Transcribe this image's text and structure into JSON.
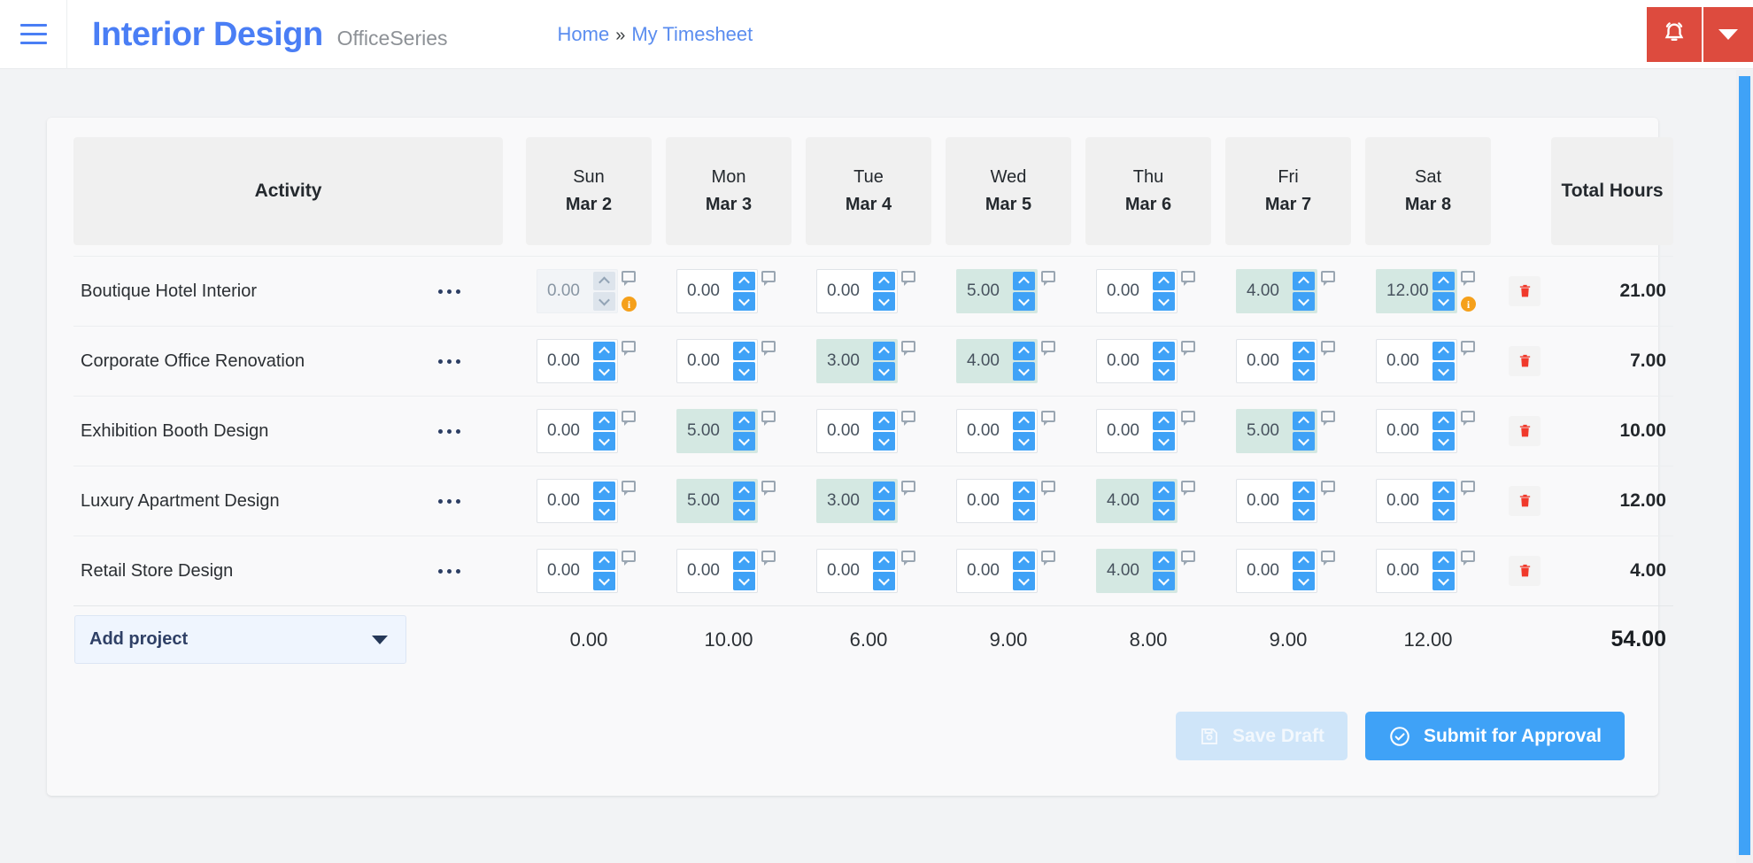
{
  "header": {
    "menu_icon": "hamburger-icon",
    "brand_title": "Interior Design",
    "brand_subtitle": "OfficeSeries",
    "breadcrumb": {
      "home": "Home",
      "separator": "»",
      "current": "My Timesheet"
    },
    "notification_icon": "bell-icon",
    "dropdown_icon": "caret-down-icon",
    "accent_red": "#dd4b3e",
    "accent_blue": "#4a7ef5"
  },
  "table": {
    "activity_header": "Activity",
    "total_header": "Total Hours",
    "days": [
      {
        "name": "Sun",
        "date": "Mar 2"
      },
      {
        "name": "Mon",
        "date": "Mar 3"
      },
      {
        "name": "Tue",
        "date": "Mar 4"
      },
      {
        "name": "Wed",
        "date": "Mar 5"
      },
      {
        "name": "Thu",
        "date": "Mar 6"
      },
      {
        "name": "Fri",
        "date": "Mar 7"
      },
      {
        "name": "Sat",
        "date": "Mar 8"
      }
    ],
    "rows": [
      {
        "activity": "Boutique Hotel Interior",
        "total": "21.00",
        "cells": [
          {
            "value": "0.00",
            "state": "disabled",
            "badge": "i"
          },
          {
            "value": "0.00",
            "state": "empty",
            "badge": ""
          },
          {
            "value": "0.00",
            "state": "empty",
            "badge": ""
          },
          {
            "value": "5.00",
            "state": "filled",
            "badge": ""
          },
          {
            "value": "0.00",
            "state": "empty",
            "badge": ""
          },
          {
            "value": "4.00",
            "state": "filled",
            "badge": ""
          },
          {
            "value": "12.00",
            "state": "filled",
            "badge": "i"
          }
        ]
      },
      {
        "activity": "Corporate Office Renovation",
        "total": "7.00",
        "cells": [
          {
            "value": "0.00",
            "state": "empty",
            "badge": ""
          },
          {
            "value": "0.00",
            "state": "empty",
            "badge": ""
          },
          {
            "value": "3.00",
            "state": "filled",
            "badge": ""
          },
          {
            "value": "4.00",
            "state": "filled",
            "badge": ""
          },
          {
            "value": "0.00",
            "state": "empty",
            "badge": ""
          },
          {
            "value": "0.00",
            "state": "empty",
            "badge": ""
          },
          {
            "value": "0.00",
            "state": "empty",
            "badge": ""
          }
        ]
      },
      {
        "activity": "Exhibition Booth Design",
        "total": "10.00",
        "cells": [
          {
            "value": "0.00",
            "state": "empty",
            "badge": ""
          },
          {
            "value": "5.00",
            "state": "filled",
            "badge": ""
          },
          {
            "value": "0.00",
            "state": "empty",
            "badge": ""
          },
          {
            "value": "0.00",
            "state": "empty",
            "badge": ""
          },
          {
            "value": "0.00",
            "state": "empty",
            "badge": ""
          },
          {
            "value": "5.00",
            "state": "filled",
            "badge": ""
          },
          {
            "value": "0.00",
            "state": "empty",
            "badge": ""
          }
        ]
      },
      {
        "activity": "Luxury Apartment Design",
        "total": "12.00",
        "cells": [
          {
            "value": "0.00",
            "state": "empty",
            "badge": ""
          },
          {
            "value": "5.00",
            "state": "filled",
            "badge": ""
          },
          {
            "value": "3.00",
            "state": "filled",
            "badge": ""
          },
          {
            "value": "0.00",
            "state": "empty",
            "badge": ""
          },
          {
            "value": "4.00",
            "state": "filled",
            "badge": ""
          },
          {
            "value": "0.00",
            "state": "empty",
            "badge": ""
          },
          {
            "value": "0.00",
            "state": "empty",
            "badge": ""
          }
        ]
      },
      {
        "activity": "Retail Store Design",
        "total": "4.00",
        "cells": [
          {
            "value": "0.00",
            "state": "empty",
            "badge": ""
          },
          {
            "value": "0.00",
            "state": "empty",
            "badge": ""
          },
          {
            "value": "0.00",
            "state": "empty",
            "badge": ""
          },
          {
            "value": "0.00",
            "state": "empty",
            "badge": ""
          },
          {
            "value": "4.00",
            "state": "filled",
            "badge": ""
          },
          {
            "value": "0.00",
            "state": "empty",
            "badge": ""
          },
          {
            "value": "0.00",
            "state": "empty",
            "badge": ""
          }
        ]
      }
    ],
    "footer": {
      "add_project_label": "Add project",
      "day_totals": [
        "0.00",
        "10.00",
        "6.00",
        "9.00",
        "8.00",
        "9.00",
        "12.00"
      ],
      "grand_total": "54.00"
    }
  },
  "actions": {
    "save_draft_label": "Save Draft",
    "save_draft_icon": "save-icon",
    "submit_label": "Submit for Approval",
    "submit_icon": "check-circle-icon",
    "submit_color": "#3fa2f7",
    "draft_color": "#cfe5f9"
  }
}
